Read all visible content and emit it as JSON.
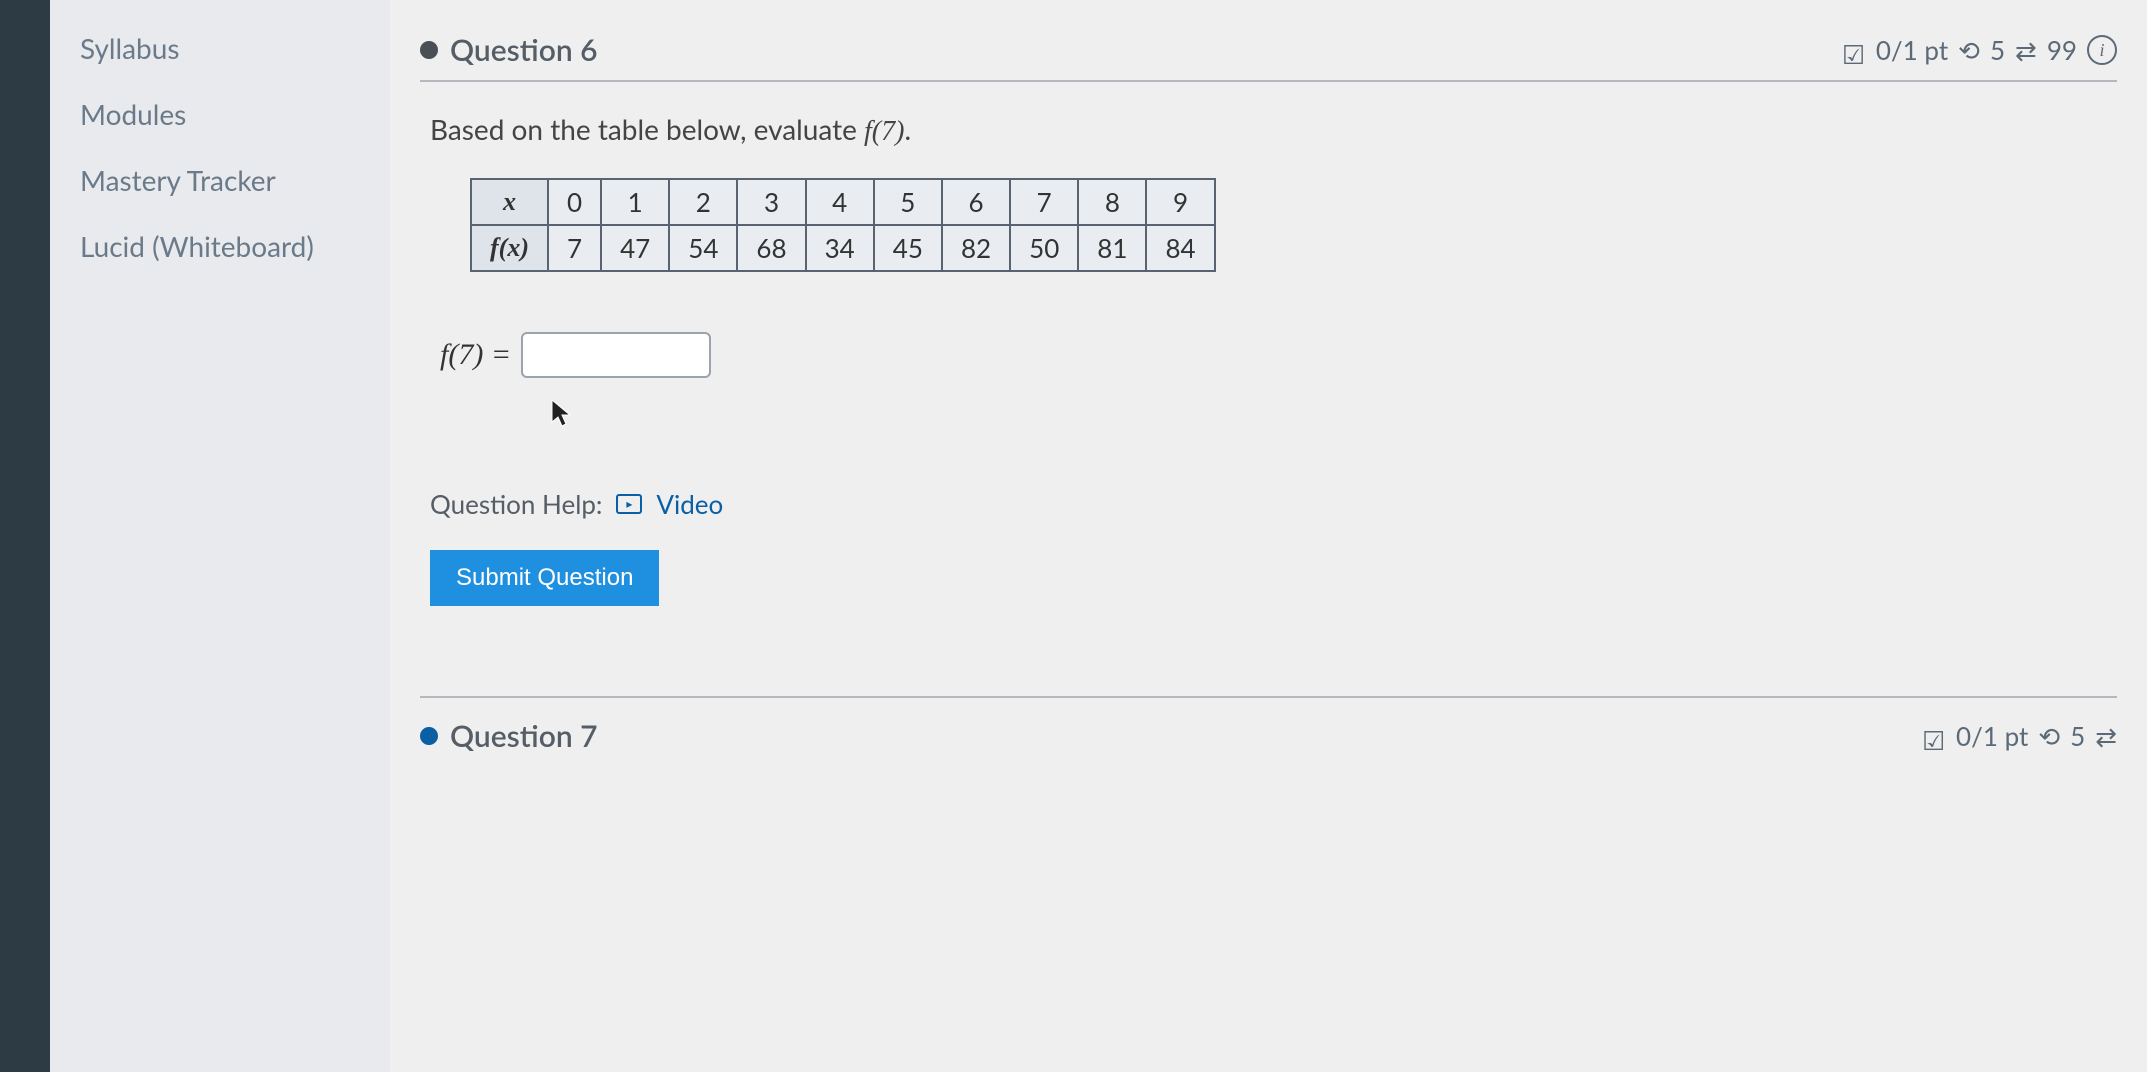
{
  "sidebar": {
    "items": [
      {
        "label": "Syllabus"
      },
      {
        "label": "Modules"
      },
      {
        "label": "Mastery Tracker"
      },
      {
        "label": "Lucid (Whiteboard)"
      }
    ]
  },
  "question6": {
    "title": "Question 6",
    "meta": {
      "points": "0/1 pt",
      "attempts_icon_value": "5",
      "retry_value": "99"
    },
    "prompt_prefix": "Based on the table below, evaluate ",
    "prompt_math": "f(7)",
    "prompt_suffix": ".",
    "table": {
      "row1_label": "x",
      "row2_label": "f(x)",
      "x_values": [
        "0",
        "1",
        "2",
        "3",
        "4",
        "5",
        "6",
        "7",
        "8",
        "9"
      ],
      "fx_values": [
        "7",
        "47",
        "54",
        "68",
        "34",
        "45",
        "82",
        "50",
        "81",
        "84"
      ]
    },
    "answer_label": "f(7) =",
    "answer_value": "",
    "help_label": "Question Help:",
    "video_label": "Video",
    "submit_label": "Submit Question"
  },
  "question7": {
    "title": "Question 7",
    "meta": {
      "points": "0/1 pt",
      "attempts_icon_value": "5"
    }
  }
}
